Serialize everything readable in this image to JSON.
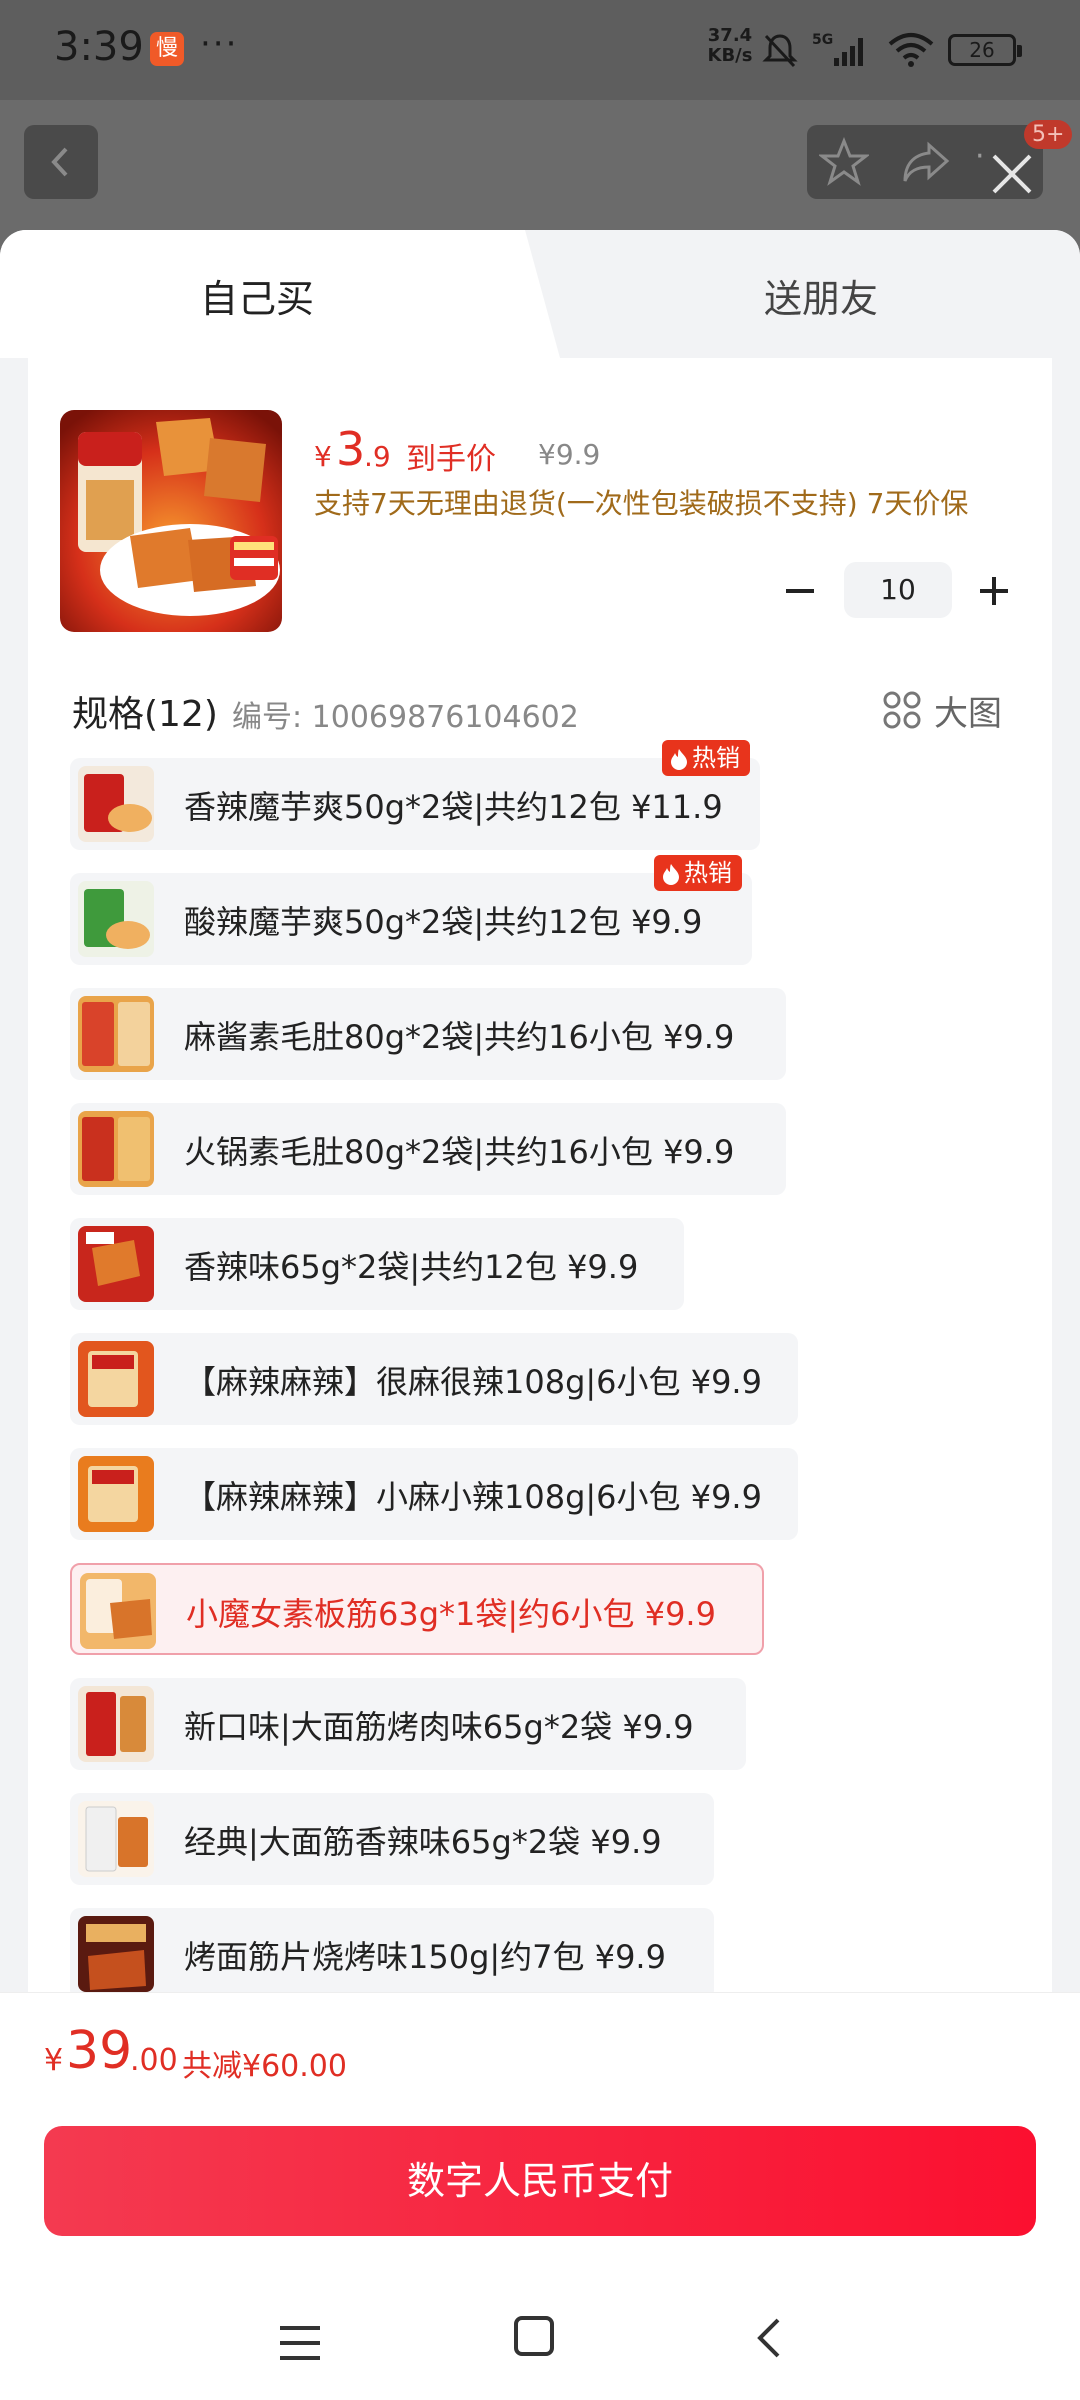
{
  "status_bar": {
    "time": "3:39",
    "app_badge": "慢",
    "dots": "···",
    "net_speed_value": "37.4",
    "net_speed_unit": "KB/s",
    "battery": "26"
  },
  "header": {
    "cart_badge": "5+"
  },
  "tabs": {
    "self": "自己买",
    "friend": "送朋友"
  },
  "product": {
    "currency": "¥",
    "price_int": "3",
    "price_dec": ".9",
    "price_label": "到手价",
    "original_price": "¥9.9",
    "guarantee": "支持7天无理由退货(一次性包装破损不支持) 7天价保",
    "quantity": "10"
  },
  "spec": {
    "title": "规格(12)",
    "code": "编号: 10069876104602",
    "big_view": "大图",
    "hot_label": "热销"
  },
  "options": [
    {
      "label": "香辣魔芋爽50g*2袋|共约12包   ¥11.9",
      "hot": true
    },
    {
      "label": "酸辣魔芋爽50g*2袋|共约12包   ¥9.9",
      "hot": true
    },
    {
      "label": "麻酱素毛肚80g*2袋|共约16小包   ¥9.9",
      "hot": false
    },
    {
      "label": "火锅素毛肚80g*2袋|共约16小包   ¥9.9",
      "hot": false
    },
    {
      "label": "香辣味65g*2袋|共约12包   ¥9.9",
      "hot": false
    },
    {
      "label": "【麻辣麻辣】很麻很辣108g|6小包   ¥9.9",
      "hot": false
    },
    {
      "label": "【麻辣麻辣】小麻小辣108g|6小包   ¥9.9",
      "hot": false
    },
    {
      "label": "小魔女素板筋63g*1袋|约6小包   ¥9.9",
      "hot": false,
      "selected": true
    },
    {
      "label": "新口味|大面筋烤肉味65g*2袋   ¥9.9",
      "hot": false
    },
    {
      "label": "经典|大面筋香辣味65g*2袋   ¥9.9",
      "hot": false
    },
    {
      "label": "烤面筋片烧烤味150g|约7包   ¥9.9",
      "hot": false
    }
  ],
  "footer": {
    "currency": "¥",
    "total_int": "39",
    "total_dec": ".00",
    "discount": "共减¥60.00",
    "pay_button": "数字人民币支付"
  },
  "colors": {
    "accent": "#e02e24",
    "pay_start": "#f43a50",
    "pay_end": "#fb1030"
  }
}
